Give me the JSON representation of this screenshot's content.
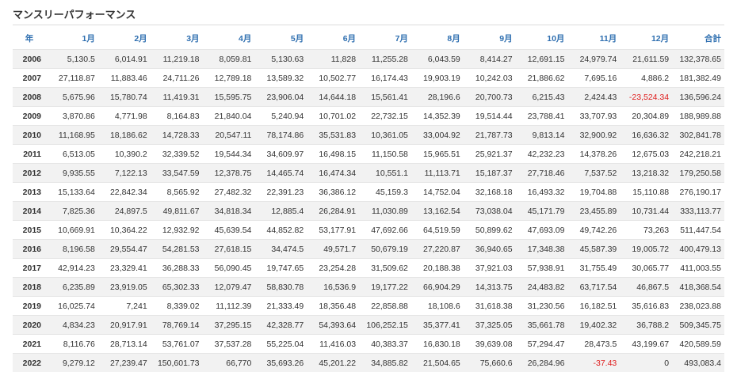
{
  "title": "マンスリーパフォーマンス",
  "headers": [
    "年",
    "1月",
    "2月",
    "3月",
    "4月",
    "5月",
    "6月",
    "7月",
    "8月",
    "9月",
    "10月",
    "11月",
    "12月",
    "合計"
  ],
  "negative_color": "#e02020",
  "header_color": "#2f6fb0",
  "rows": [
    [
      "2006",
      "5,130.5",
      "6,014.91",
      "11,219.18",
      "8,059.81",
      "5,130.63",
      "11,828",
      "11,255.28",
      "6,043.59",
      "8,414.27",
      "12,691.15",
      "24,979.74",
      "21,611.59",
      "132,378.65"
    ],
    [
      "2007",
      "27,118.87",
      "11,883.46",
      "24,711.26",
      "12,789.18",
      "13,589.32",
      "10,502.77",
      "16,174.43",
      "19,903.19",
      "10,242.03",
      "21,886.62",
      "7,695.16",
      "4,886.2",
      "181,382.49"
    ],
    [
      "2008",
      "5,675.96",
      "15,780.74",
      "11,419.31",
      "15,595.75",
      "23,906.04",
      "14,644.18",
      "15,561.41",
      "28,196.6",
      "20,700.73",
      "6,215.43",
      "2,424.43",
      "-23,524.34",
      "136,596.24"
    ],
    [
      "2009",
      "3,870.86",
      "4,771.98",
      "8,164.83",
      "21,840.04",
      "5,240.94",
      "10,701.02",
      "22,732.15",
      "14,352.39",
      "19,514.44",
      "23,788.41",
      "33,707.93",
      "20,304.89",
      "188,989.88"
    ],
    [
      "2010",
      "11,168.95",
      "18,186.62",
      "14,728.33",
      "20,547.11",
      "78,174.86",
      "35,531.83",
      "10,361.05",
      "33,004.92",
      "21,787.73",
      "9,813.14",
      "32,900.92",
      "16,636.32",
      "302,841.78"
    ],
    [
      "2011",
      "6,513.05",
      "10,390.2",
      "32,339.52",
      "19,544.34",
      "34,609.97",
      "16,498.15",
      "11,150.58",
      "15,965.51",
      "25,921.37",
      "42,232.23",
      "14,378.26",
      "12,675.03",
      "242,218.21"
    ],
    [
      "2012",
      "9,935.55",
      "7,122.13",
      "33,547.59",
      "12,378.75",
      "14,465.74",
      "16,474.34",
      "10,551.1",
      "11,113.71",
      "15,187.37",
      "27,718.46",
      "7,537.52",
      "13,218.32",
      "179,250.58"
    ],
    [
      "2013",
      "15,133.64",
      "22,842.34",
      "8,565.92",
      "27,482.32",
      "22,391.23",
      "36,386.12",
      "45,159.3",
      "14,752.04",
      "32,168.18",
      "16,493.32",
      "19,704.88",
      "15,110.88",
      "276,190.17"
    ],
    [
      "2014",
      "7,825.36",
      "24,897.5",
      "49,811.67",
      "34,818.34",
      "12,885.4",
      "26,284.91",
      "11,030.89",
      "13,162.54",
      "73,038.04",
      "45,171.79",
      "23,455.89",
      "10,731.44",
      "333,113.77"
    ],
    [
      "2015",
      "10,669.91",
      "10,364.22",
      "12,932.92",
      "45,639.54",
      "44,852.82",
      "53,177.91",
      "47,692.66",
      "64,519.59",
      "50,899.62",
      "47,693.09",
      "49,742.26",
      "73,263",
      "511,447.54"
    ],
    [
      "2016",
      "8,196.58",
      "29,554.47",
      "54,281.53",
      "27,618.15",
      "34,474.5",
      "49,571.7",
      "50,679.19",
      "27,220.87",
      "36,940.65",
      "17,348.38",
      "45,587.39",
      "19,005.72",
      "400,479.13"
    ],
    [
      "2017",
      "42,914.23",
      "23,329.41",
      "36,288.33",
      "56,090.45",
      "19,747.65",
      "23,254.28",
      "31,509.62",
      "20,188.38",
      "37,921.03",
      "57,938.91",
      "31,755.49",
      "30,065.77",
      "411,003.55"
    ],
    [
      "2018",
      "6,235.89",
      "23,919.05",
      "65,302.33",
      "12,079.47",
      "58,830.78",
      "16,536.9",
      "19,177.22",
      "66,904.29",
      "14,313.75",
      "24,483.82",
      "63,717.54",
      "46,867.5",
      "418,368.54"
    ],
    [
      "2019",
      "16,025.74",
      "7,241",
      "8,339.02",
      "11,112.39",
      "21,333.49",
      "18,356.48",
      "22,858.88",
      "18,108.6",
      "31,618.38",
      "31,230.56",
      "16,182.51",
      "35,616.83",
      "238,023.88"
    ],
    [
      "2020",
      "4,834.23",
      "20,917.91",
      "78,769.14",
      "37,295.15",
      "42,328.77",
      "54,393.64",
      "106,252.15",
      "35,377.41",
      "37,325.05",
      "35,661.78",
      "19,402.32",
      "36,788.2",
      "509,345.75"
    ],
    [
      "2021",
      "8,116.76",
      "28,713.14",
      "53,761.07",
      "37,537.28",
      "55,225.04",
      "11,416.03",
      "40,383.37",
      "16,830.18",
      "39,639.08",
      "57,294.47",
      "28,473.5",
      "43,199.67",
      "420,589.59"
    ],
    [
      "2022",
      "9,279.12",
      "27,239.47",
      "150,601.73",
      "66,770",
      "35,693.26",
      "45,201.22",
      "34,885.82",
      "21,504.65",
      "75,660.6",
      "26,284.96",
      "-37.43",
      "0",
      "493,083.4"
    ]
  ]
}
